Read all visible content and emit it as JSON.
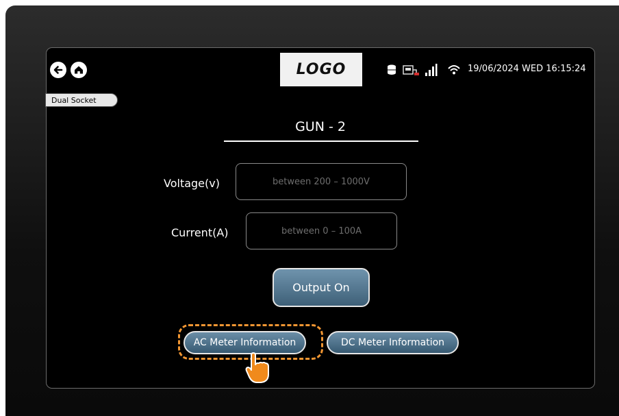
{
  "header": {
    "logo_text": "LOGO",
    "datetime": "19/06/2024 WED 16:15:24",
    "back_icon": "back-arrow-icon",
    "home_icon": "home-icon",
    "status_icons": [
      "database-icon",
      "charger-icon",
      "signal-bars-icon",
      "wifi-icon"
    ]
  },
  "mode_tag": "Dual Socket",
  "gun_title": "GUN - 2",
  "fields": {
    "voltage": {
      "label": "Voltage(v)",
      "placeholder": "between 200 – 1000V"
    },
    "current": {
      "label": "Current(A)",
      "placeholder": "between 0 – 100A"
    }
  },
  "buttons": {
    "output_on": "Output On",
    "ac_meter": "AC Meter Information",
    "dc_meter": "DC Meter Information"
  },
  "colors": {
    "highlight": "#f29632",
    "button_gradient_top": "#6f93ad",
    "button_gradient_bottom": "#3e6078"
  },
  "pointer": "hand-pointer-icon"
}
